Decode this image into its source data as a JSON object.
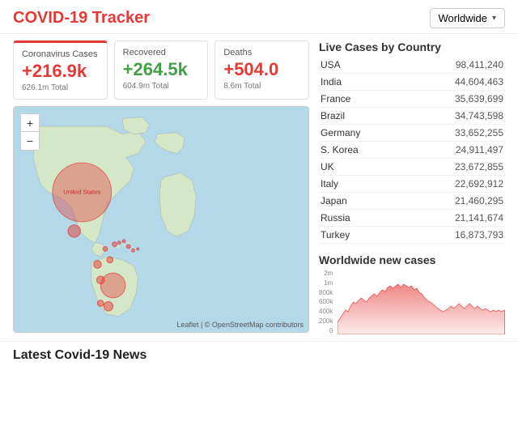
{
  "header": {
    "title": "COVID-19 Tracker",
    "dropdown_label": "Worldwide",
    "dropdown_arrow": "▾"
  },
  "stats": {
    "cases": {
      "label": "Coronavirus Cases",
      "value": "+216.9k",
      "total": "626.1m Total"
    },
    "recovered": {
      "label": "Recovered",
      "value": "+264.5k",
      "total": "604.9m Total"
    },
    "deaths": {
      "label": "Deaths",
      "value": "+504.0",
      "total": "8.6m Total"
    }
  },
  "map": {
    "zoom_in": "+",
    "zoom_out": "−",
    "attribution": "Leaflet | © OpenStreetMap contributors"
  },
  "live_cases": {
    "title": "Live Cases by Country",
    "countries": [
      {
        "name": "USA",
        "cases": "98,411,240"
      },
      {
        "name": "India",
        "cases": "44,604,463"
      },
      {
        "name": "France",
        "cases": "35,639,699"
      },
      {
        "name": "Brazil",
        "cases": "34,743,598"
      },
      {
        "name": "Germany",
        "cases": "33,652,255"
      },
      {
        "name": "S. Korea",
        "cases": "24,911,497"
      },
      {
        "name": "UK",
        "cases": "23,672,855"
      },
      {
        "name": "Italy",
        "cases": "22,692,912"
      },
      {
        "name": "Japan",
        "cases": "21,460,295"
      },
      {
        "name": "Russia",
        "cases": "21,141,674"
      },
      {
        "name": "Turkey",
        "cases": "16,873,793"
      }
    ]
  },
  "chart": {
    "title": "Worldwide new cases",
    "y_labels": [
      "2m",
      "1m",
      "800k",
      "600k",
      "400k",
      "200k",
      "0"
    ]
  },
  "footer": {
    "title": "Latest Covid-19 News"
  }
}
